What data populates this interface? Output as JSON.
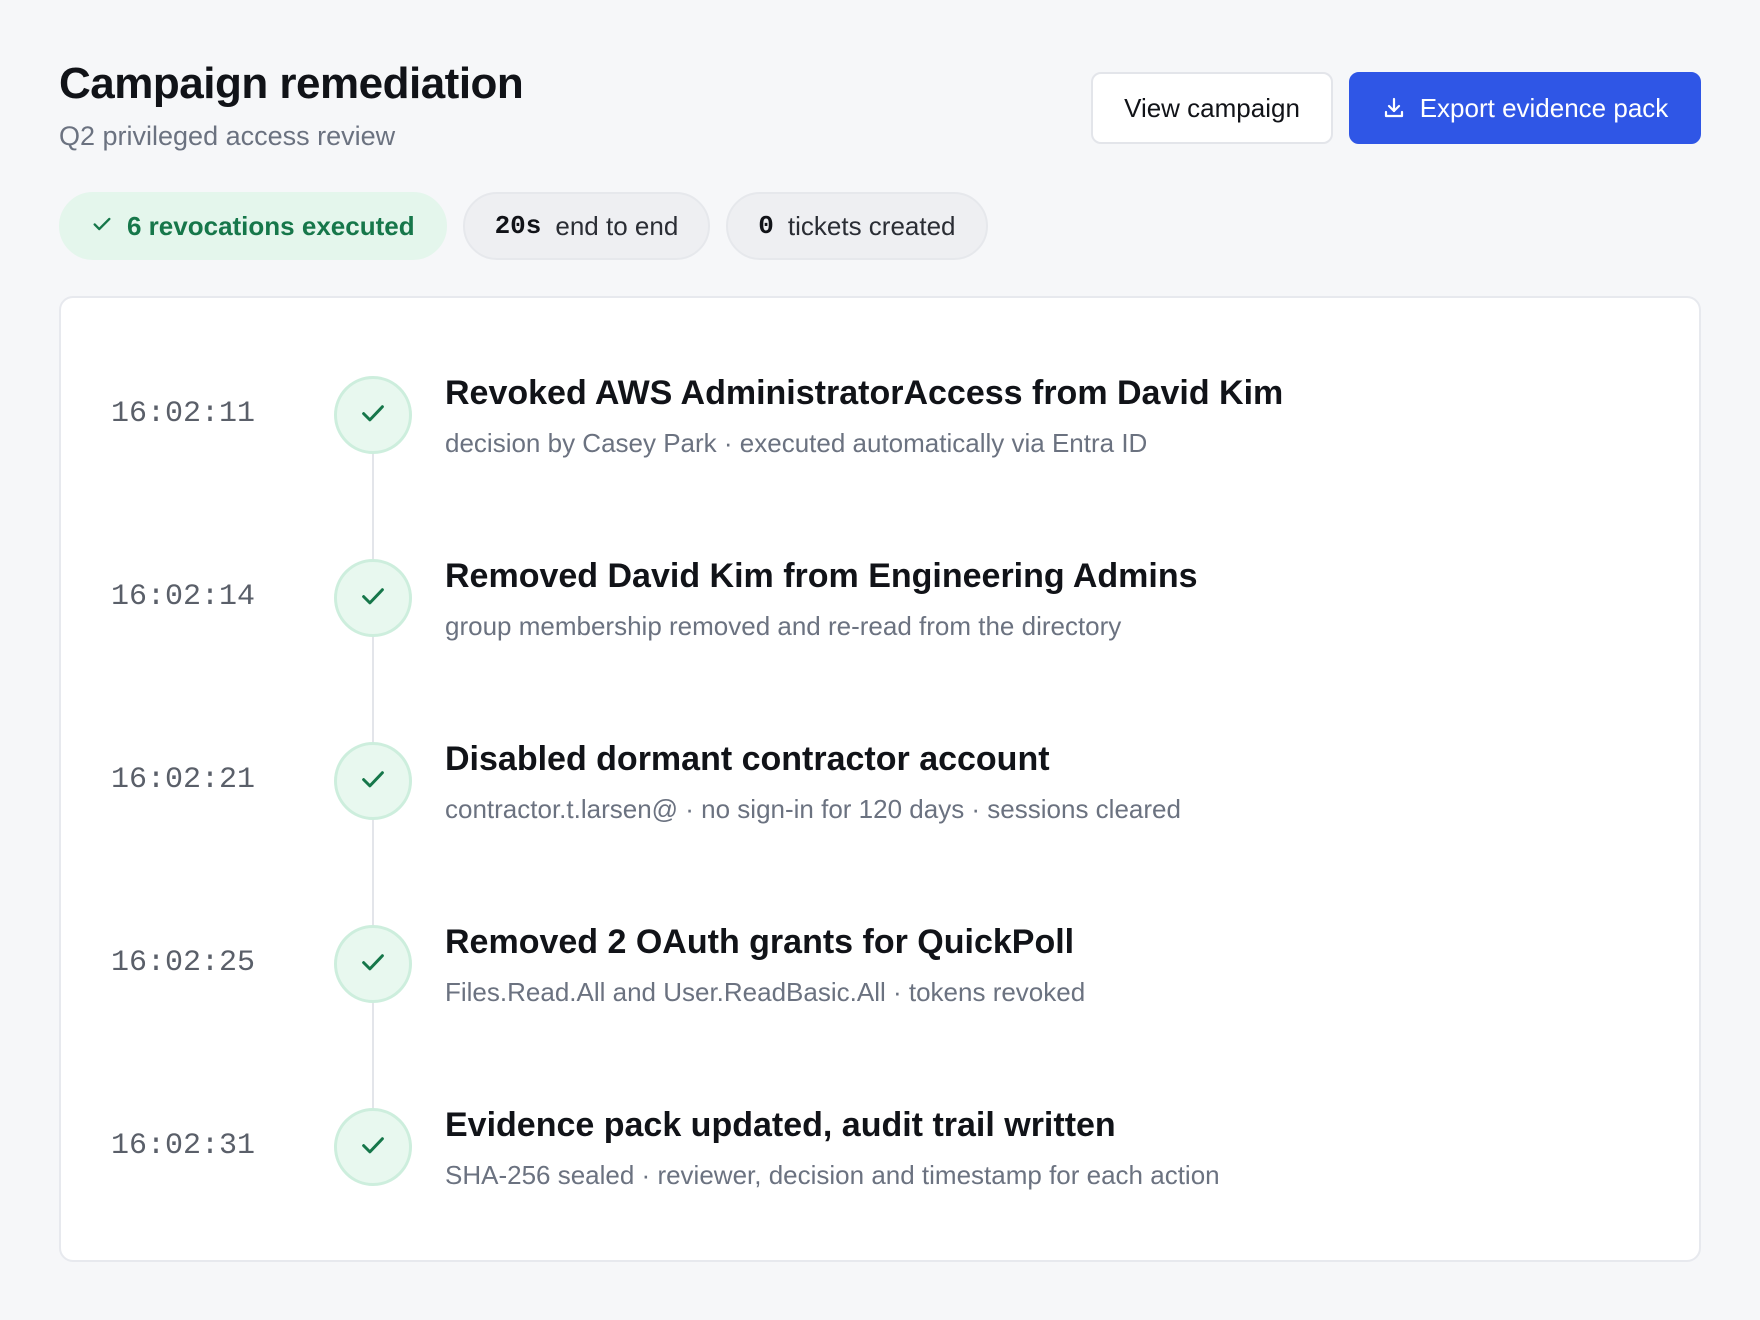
{
  "header": {
    "title": "Campaign remediation",
    "subtitle": "Q2 privileged access review"
  },
  "actions": {
    "view_campaign_label": "View campaign",
    "export_label": "Export evidence pack"
  },
  "stats": {
    "revocations": "6 revocations executed",
    "duration_value": "20s",
    "duration_label": "end to end",
    "tickets_value": "0",
    "tickets_label": "tickets created"
  },
  "events": [
    {
      "time": "16:02:11",
      "title": "Revoked AWS AdministratorAccess from David Kim",
      "detail": "decision by Casey Park · executed automatically via Entra ID"
    },
    {
      "time": "16:02:14",
      "title": "Removed David Kim from Engineering Admins",
      "detail": "group membership removed and re-read from the directory"
    },
    {
      "time": "16:02:21",
      "title": "Disabled dormant contractor account",
      "detail": "contractor.t.larsen@ · no sign-in for 120 days · sessions cleared"
    },
    {
      "time": "16:02:25",
      "title": "Removed 2 OAuth grants for QuickPoll",
      "detail": "Files.Read.All and User.ReadBasic.All · tokens revoked"
    },
    {
      "time": "16:02:31",
      "title": "Evidence pack updated, audit trail written",
      "detail": "SHA-256 sealed · reviewer, decision and timestamp for each action"
    }
  ],
  "colors": {
    "primary": "#2f56e6",
    "success": "#16774a",
    "success_bg": "#e4f6ec",
    "muted_text": "#6b7280"
  },
  "icons": {
    "export": "download-icon",
    "success": "check-icon"
  }
}
